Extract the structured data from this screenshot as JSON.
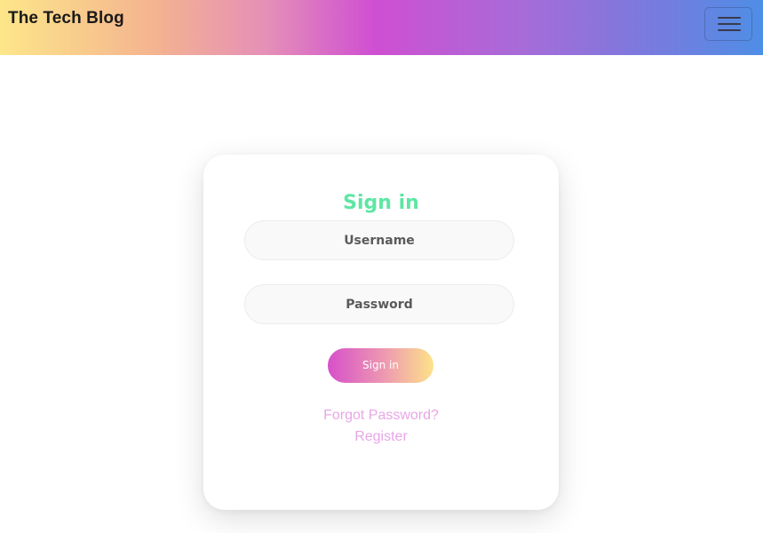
{
  "navbar": {
    "brand": "The Tech Blog",
    "toggler_icon": "hamburger-menu-icon"
  },
  "login": {
    "title": "Sign in",
    "username_placeholder": "Username",
    "password_placeholder": "Password",
    "submit_label": "Sign in",
    "forgot_label": "Forgot Password?",
    "register_label": "Register"
  },
  "colors": {
    "title": "#5ee6a4",
    "link": "#e7a6e6",
    "gradient_start": "#fde68a",
    "gradient_mid": "#cf4fd2",
    "gradient_end": "#4e8ee6"
  }
}
